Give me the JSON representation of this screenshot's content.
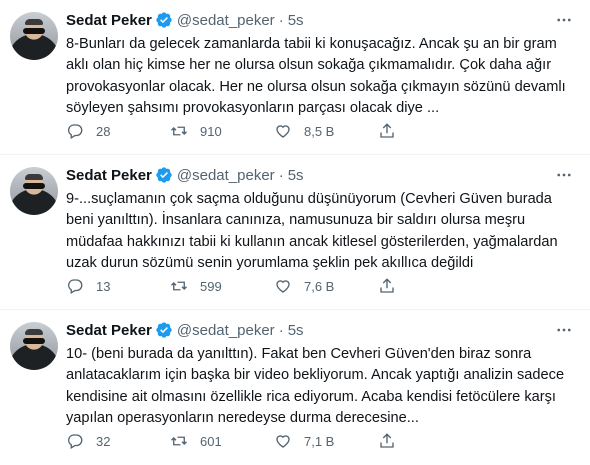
{
  "tweets": [
    {
      "name": "Sedat Peker",
      "handle": "@sedat_peker",
      "separator": "·",
      "time": "5s",
      "text": "8-Bunları da gelecek zamanlarda tabii ki konuşacağız. Ancak şu an bir gram aklı olan hiç kimse her ne olursa olsun sokağa çıkmamalıdır. Çok daha ağır provokasyonlar olacak. Her ne olursa olsun sokağa çıkmayın sözünü devamlı söyleyen şahsımı provokasyonların parçası olacak diye ...",
      "replies": "28",
      "retweets": "910",
      "likes": "8,5 B"
    },
    {
      "name": "Sedat Peker",
      "handle": "@sedat_peker",
      "separator": "·",
      "time": "5s",
      "text": "9-...suçlamanın çok saçma olduğunu düşünüyorum (Cevheri Güven burada beni yanılttın). İnsanlara canınıza, namusunuza bir saldırı olursa meşru müdafaa hakkınızı tabii ki kullanın ancak kitlesel gösterilerden, yağmalardan uzak durun sözümü senin yorumlama şeklin pek akıllıca değildi",
      "replies": "13",
      "retweets": "599",
      "likes": "7,6 B"
    },
    {
      "name": "Sedat Peker",
      "handle": "@sedat_peker",
      "separator": "·",
      "time": "5s",
      "text": "10- (beni burada da yanılttın). Fakat ben Cevheri Güven'den biraz sonra anlatacaklarım için başka bir video bekliyorum. Ancak yaptığı analizin sadece kendisine ait olmasını özellikle rica ediyorum. Acaba kendisi fetöcülere karşı yapılan operasyonların neredeyse durma derecesine...",
      "replies": "32",
      "retweets": "601",
      "likes": "7,1 B"
    }
  ],
  "icons": {
    "more": "more-horizontal-icon",
    "verified": "verified-badge-icon",
    "reply": "reply-icon",
    "retweet": "retweet-icon",
    "like": "heart-icon",
    "share": "share-icon"
  },
  "colors": {
    "verified": "#1d9bf0",
    "secondary_text": "#536471",
    "primary_text": "#0f1419",
    "divider": "#eff3f4"
  }
}
